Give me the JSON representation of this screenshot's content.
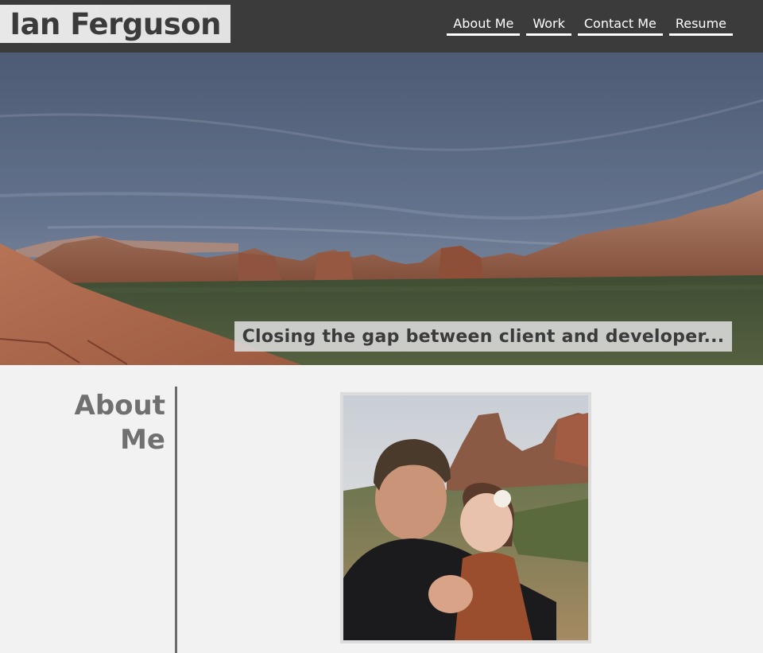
{
  "header": {
    "brand": "Ian Ferguson",
    "nav": [
      {
        "label": "About Me"
      },
      {
        "label": "Work"
      },
      {
        "label": "Contact Me"
      },
      {
        "label": "Resume"
      }
    ]
  },
  "hero": {
    "tagline": "Closing the gap between client and developer..."
  },
  "about": {
    "heading_line1": "About",
    "heading_line2": "Me"
  },
  "colors": {
    "header_bg": "#3b3b3b",
    "page_bg": "#f2f2f2",
    "heading_text": "#707070"
  }
}
